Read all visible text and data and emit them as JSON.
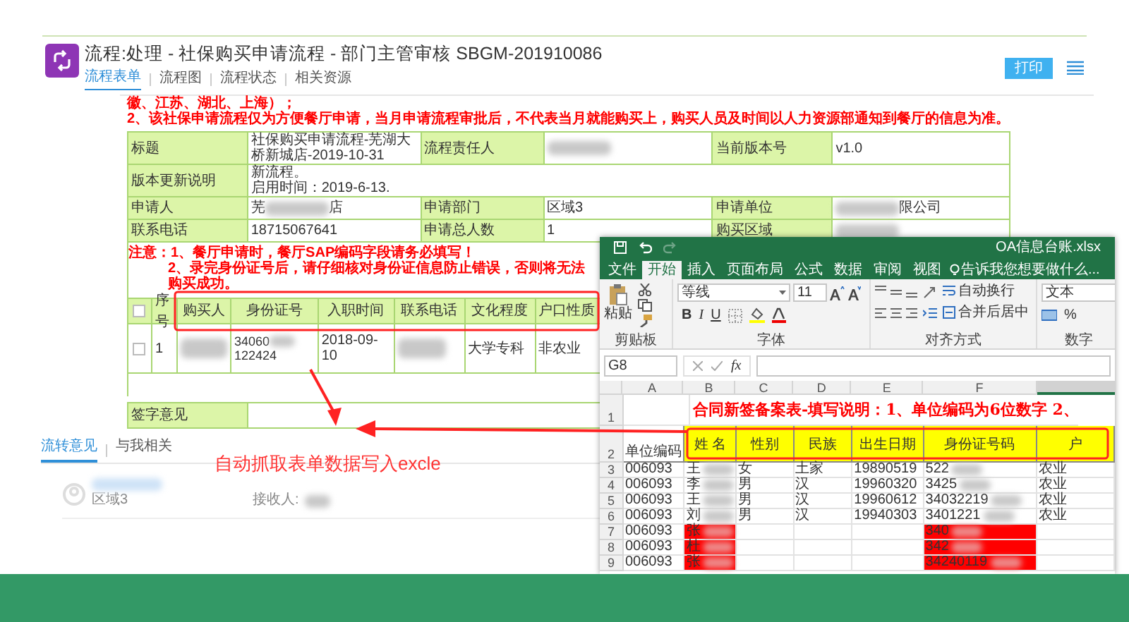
{
  "page_header": {
    "title": "流程:处理 - 社保购买申请流程 - 部门主管审核 SBGM-201910086",
    "tabs": [
      {
        "label": "流程表单",
        "selected": true
      },
      {
        "label": "流程图",
        "selected": false
      },
      {
        "label": "流程状态",
        "selected": false
      },
      {
        "label": "相关资源",
        "selected": false
      }
    ],
    "print_button": "打印"
  },
  "notices": [
    "徽、江苏、湖北、上海）；",
    "2、该社保申请流程仅为方便餐厅申请，当月申请流程审批后，不代表当月就能购买上，购买人员及时间以人力资源部通知到餐厅的信息为准。"
  ],
  "form": {
    "rows": [
      [
        {
          "kind": "label",
          "text": "标题"
        },
        {
          "kind": "value",
          "text": "社保购买申请流程-芜湖大桥新城店-2019-10-31"
        },
        {
          "kind": "label",
          "text": "流程责任人"
        },
        {
          "kind": "masked"
        },
        {
          "kind": "label",
          "text": "当前版本号"
        },
        {
          "kind": "value",
          "text": "v1.0"
        }
      ],
      [
        {
          "kind": "label",
          "text": "版本更新说明"
        },
        {
          "kind": "wide",
          "lines": [
            "新流程。",
            "启用时间：2019-6-13."
          ]
        }
      ],
      [
        {
          "kind": "label",
          "text": "申请人"
        },
        {
          "kind": "masked",
          "before": "芜",
          "after": "店"
        },
        {
          "kind": "label",
          "text": "申请部门"
        },
        {
          "kind": "value",
          "text": "区域3"
        },
        {
          "kind": "label",
          "text": "申请单位"
        },
        {
          "kind": "masked",
          "after": "限公司"
        }
      ],
      [
        {
          "kind": "label",
          "text": "联系电话"
        },
        {
          "kind": "value",
          "text": "18715067641"
        },
        {
          "kind": "label",
          "text": "申请总人数"
        },
        {
          "kind": "value",
          "text": "1"
        },
        {
          "kind": "label",
          "text": "购买区域"
        },
        {
          "kind": "masked"
        }
      ]
    ]
  },
  "warnings": [
    "注意：1、餐厅申请时，餐厅SAP编码字段请务必填写！",
    "2、录完身份证号后，请仔细核对身份证信息防止错误，否则将无法购买成功。"
  ],
  "buyers": {
    "header_checked": false,
    "columns": [
      "序号",
      "购买人",
      "身份证号",
      "入职时间",
      "联系电话",
      "文化程度",
      "户口性质"
    ],
    "rows": [
      {
        "checked": false,
        "cells": [
          {
            "kind": "value",
            "text": "1"
          },
          {
            "kind": "masked"
          },
          {
            "kind": "masked",
            "before": "34060",
            "after": "122424"
          },
          {
            "kind": "value",
            "text": "2018-09-10"
          },
          {
            "kind": "masked"
          },
          {
            "kind": "value",
            "text": "大学专科"
          },
          {
            "kind": "value",
            "text": "非农业"
          }
        ]
      }
    ]
  },
  "sign_label": "签字意见",
  "opinion_tabs": [
    {
      "label": "流转意见",
      "selected": true
    },
    {
      "label": "与我相关",
      "selected": false
    }
  ],
  "comments": [
    {
      "department": "区域3",
      "receiver_label": "接收人:"
    }
  ],
  "annotation": "自动抓取表单数据写入excle",
  "excel": {
    "file_name": "OA信息台账.xlsx",
    "tabs": [
      {
        "label": "文件",
        "selected": false
      },
      {
        "label": "开始",
        "selected": true
      },
      {
        "label": "插入",
        "selected": false
      },
      {
        "label": "页面布局",
        "selected": false
      },
      {
        "label": "公式",
        "selected": false
      },
      {
        "label": "数据",
        "selected": false
      },
      {
        "label": "审阅",
        "selected": false
      },
      {
        "label": "视图",
        "selected": false
      }
    ],
    "tell_me": "告诉我您想要做什么...",
    "paste": "粘贴",
    "font_name": "等线",
    "font_size": "11",
    "bold": "B",
    "italic": "I",
    "underline": "U",
    "wrap_text": "自动换行",
    "merge_center": "合并后居中",
    "number_format": "文本",
    "percent": "%",
    "groups": [
      "剪贴板",
      "字体",
      "对齐方式",
      "数字"
    ],
    "name_box": "G8",
    "fx": "fx",
    "columns": [
      "A",
      "B",
      "C",
      "D",
      "E",
      "F"
    ],
    "title_row": {
      "number": "1",
      "text": "合同新签备案表-填写说明：1、单位编码为6位数字 2、"
    },
    "header_row": {
      "number": "2",
      "cells": [
        "单位编码",
        "姓 名",
        "性别",
        "民族",
        "出生日期",
        "身份证号码",
        "户"
      ]
    },
    "rows": [
      {
        "number": "3",
        "cells": [
          {
            "text": "006093",
            "masked": false,
            "marked": false
          },
          {
            "text": "王",
            "masked": true,
            "marked": false
          },
          {
            "text": "女",
            "masked": false,
            "marked": false
          },
          {
            "text": "土家",
            "masked": false,
            "marked": false
          },
          {
            "text": "19890519",
            "masked": false,
            "marked": false
          },
          {
            "text": "522",
            "masked": true,
            "marked": false
          },
          {
            "text": "农业",
            "masked": false,
            "marked": false
          }
        ]
      },
      {
        "number": "4",
        "cells": [
          {
            "text": "006093",
            "masked": false,
            "marked": false
          },
          {
            "text": "李",
            "masked": true,
            "marked": false
          },
          {
            "text": "男",
            "masked": false,
            "marked": false
          },
          {
            "text": "汉",
            "masked": false,
            "marked": false
          },
          {
            "text": "19960320",
            "masked": false,
            "marked": false
          },
          {
            "text": "3425",
            "masked": true,
            "marked": false
          },
          {
            "text": "农业",
            "masked": false,
            "marked": false
          }
        ]
      },
      {
        "number": "5",
        "cells": [
          {
            "text": "006093",
            "masked": false,
            "marked": false
          },
          {
            "text": "王",
            "masked": true,
            "marked": false
          },
          {
            "text": "男",
            "masked": false,
            "marked": false
          },
          {
            "text": "汉",
            "masked": false,
            "marked": false
          },
          {
            "text": "19960612",
            "masked": false,
            "marked": false
          },
          {
            "text": "34032219",
            "masked": true,
            "marked": false
          },
          {
            "text": "农业",
            "masked": false,
            "marked": false
          }
        ]
      },
      {
        "number": "6",
        "cells": [
          {
            "text": "006093",
            "masked": false,
            "marked": false
          },
          {
            "text": "刘",
            "masked": true,
            "marked": false
          },
          {
            "text": "男",
            "masked": false,
            "marked": false
          },
          {
            "text": "汉",
            "masked": false,
            "marked": false
          },
          {
            "text": "19940303",
            "masked": false,
            "marked": false
          },
          {
            "text": "3401221",
            "masked": true,
            "marked": false
          },
          {
            "text": "农业",
            "masked": false,
            "marked": false
          }
        ]
      },
      {
        "number": "7",
        "cells": [
          {
            "text": "006093",
            "masked": false,
            "marked": false
          },
          {
            "text": "张",
            "masked": true,
            "marked": true
          },
          {
            "masked": false,
            "marked": false
          },
          {
            "masked": false,
            "marked": false
          },
          {
            "masked": false,
            "marked": false
          },
          {
            "text": "340",
            "masked": true,
            "marked": true
          },
          {
            "masked": false,
            "marked": false
          }
        ]
      },
      {
        "number": "8",
        "cells": [
          {
            "text": "006093",
            "masked": false,
            "marked": false
          },
          {
            "text": "杜",
            "masked": true,
            "marked": true
          },
          {
            "masked": false,
            "marked": false
          },
          {
            "masked": false,
            "marked": false
          },
          {
            "masked": false,
            "marked": false
          },
          {
            "text": "342",
            "masked": true,
            "marked": true
          },
          {
            "masked": false,
            "marked": false
          }
        ]
      },
      {
        "number": "9",
        "cells": [
          {
            "text": "006093",
            "masked": false,
            "marked": false
          },
          {
            "text": "张",
            "masked": true,
            "marked": true
          },
          {
            "masked": false,
            "marked": false
          },
          {
            "masked": false,
            "marked": false
          },
          {
            "masked": false,
            "marked": false
          },
          {
            "text": "34240119",
            "masked": true,
            "marked": true
          },
          {
            "masked": false,
            "marked": false
          }
        ]
      }
    ]
  }
}
